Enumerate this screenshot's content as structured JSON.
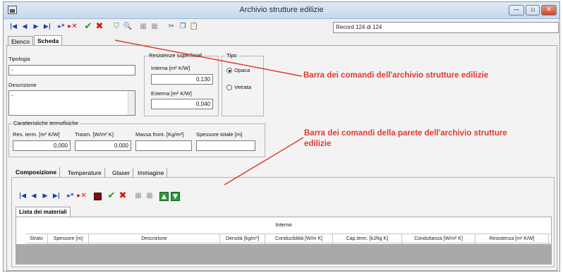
{
  "window": {
    "title": "Archivio strutture edilizie",
    "controls": [
      "—",
      "▫",
      "✕"
    ]
  },
  "toolbar": {
    "record_text": "Record 124 di 124"
  },
  "tabs_main": [
    "Elenco",
    "Scheda"
  ],
  "scheda": {
    "tipologia_label": "Tipologia",
    "tipologia_value": "-",
    "descrizione_label": "Descrizione",
    "descrizione_value": "-",
    "resistenze": {
      "title": "Resistenze superficiali",
      "interna_label": "Interna [m² K/W]",
      "interna_value": "0,130",
      "esterna_label": "Esterna [m² K/W]",
      "esterna_value": "0,040"
    },
    "tipo": {
      "title": "Tipo",
      "opaca_label": "Opaca",
      "vetrata_label": "Vetrata"
    },
    "caratteristiche": {
      "title": "Caratteristiche termofisiche",
      "res_term_label": "Res. term. [m² K/W]",
      "res_term_value": "0,000",
      "trasm_label": "Trasm. [W/m² K]",
      "trasm_value": "0,000",
      "massa_label": "Massa front. [Kg/m²]",
      "massa_value": "",
      "spessore_label": "Spessore totale [m]",
      "spessore_value": ""
    }
  },
  "tabs_sub": [
    "Composizione",
    "Temperature",
    "Glaser",
    "Immagine"
  ],
  "lista": {
    "tab_label": "Lista dei materiali",
    "interno_label": "Interno",
    "columns": [
      "Strato",
      "Spessore [m]",
      "Descrizione",
      "Densità [kg/m³]",
      "Conducibilità [W/m K]",
      "Cap.term. [kJ/kg K]",
      "Conduttanza [W/m² K]",
      "Resistenza [m² K/W]"
    ]
  },
  "annotations": {
    "archive_toolbar": "Barra dei comandi dell'archivio strutture edilizie",
    "wall_toolbar_line1": "Barra dei comandi della parete dell'archivio strutture",
    "wall_toolbar_line2": "edilizie"
  },
  "colors": {
    "annotation": "#e03a2e",
    "nav_blue": "#1a3ea8",
    "confirm_green": "#1a9a1a",
    "cancel_red": "#d11111"
  }
}
